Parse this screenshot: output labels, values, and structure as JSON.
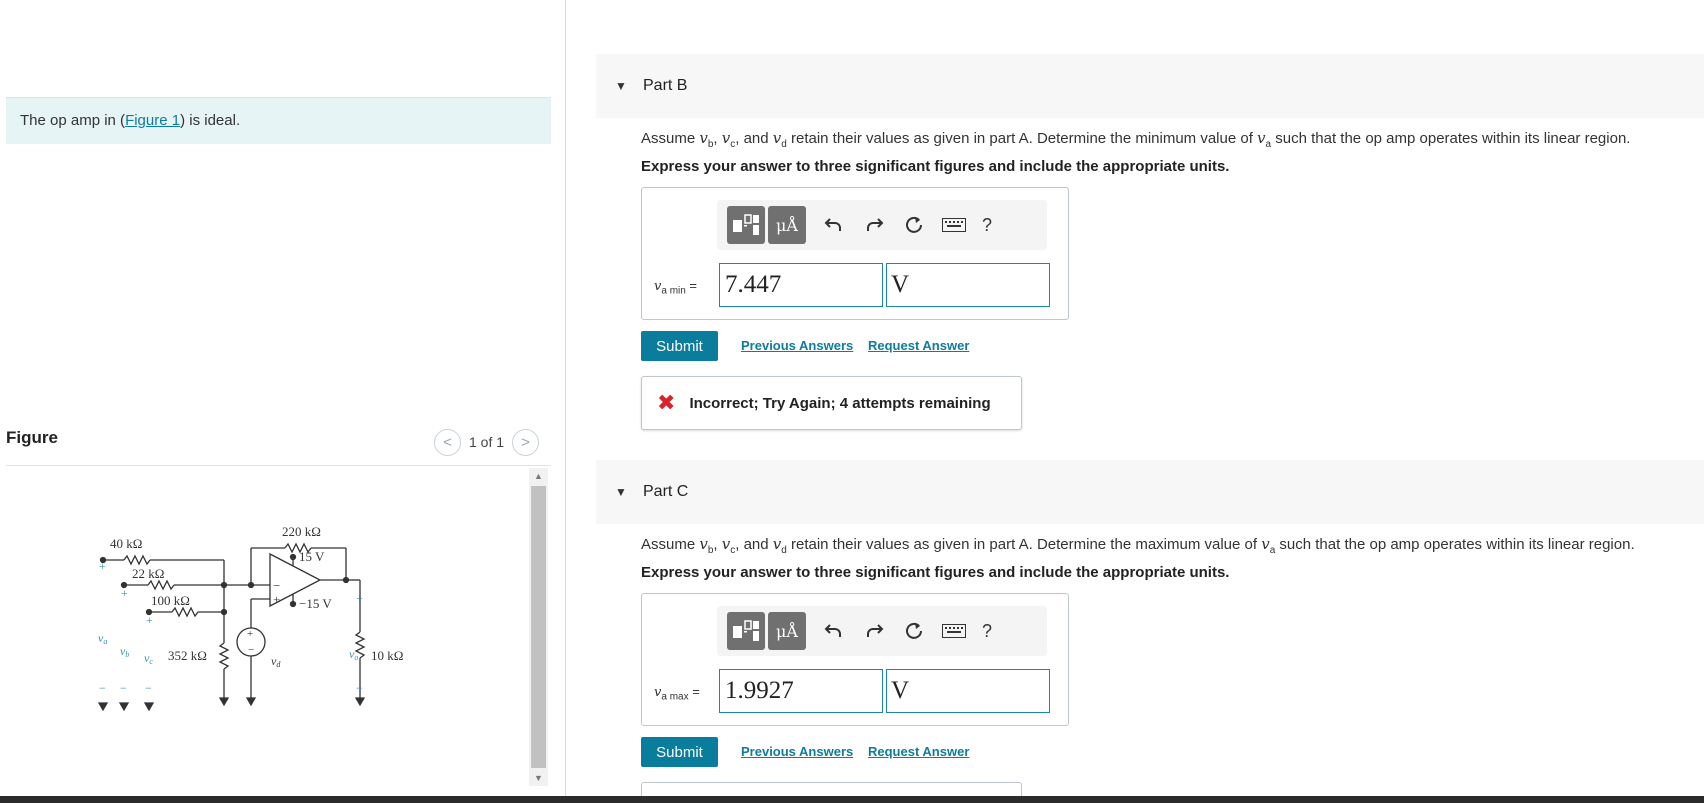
{
  "left": {
    "intro_prefix": "The op amp in (",
    "intro_link": "Figure 1",
    "intro_suffix": ") is ideal.",
    "figure_heading": "Figure",
    "pager_text": "1 of 1",
    "pager_prev": "<",
    "pager_next": ">"
  },
  "circuit": {
    "r1": "40 kΩ",
    "r2": "22 kΩ",
    "r3": "100 kΩ",
    "r4": "352 kΩ",
    "rf": "220 kΩ",
    "rl": "10 kΩ",
    "vpos": "15 V",
    "vneg": "−15 V",
    "plus": "+",
    "minus": "−",
    "va": "v",
    "va_sub": "a",
    "vb": "v",
    "vb_sub": "b",
    "vc": "v",
    "vc_sub": "c",
    "vd": "v",
    "vd_sub": "d",
    "vo": "v",
    "vo_sub": "o"
  },
  "partB": {
    "title": "Part B",
    "q_1": "Assume ",
    "q_vb": "v",
    "q_vb_sub": "b",
    "q_2": ", ",
    "q_vc": "v",
    "q_vc_sub": "c",
    "q_3": ", and ",
    "q_vd": "v",
    "q_vd_sub": "d",
    "q_4": " retain their values as given in part A. Determine the minimum value of ",
    "q_va": "v",
    "q_va_sub": "a",
    "q_5": " such that the op amp operates within its linear region.",
    "instruction": "Express your answer to three significant figures and include the appropriate units.",
    "label_var": "v",
    "label_sub": "a min",
    "label_eq": " =",
    "value": "7.447",
    "unit": "V",
    "submit": "Submit",
    "prev_answers": "Previous Answers",
    "request_answer": "Request Answer",
    "feedback_icon": "✖",
    "feedback": "Incorrect; Try Again; 4 attempts remaining"
  },
  "partC": {
    "title": "Part C",
    "q_1": "Assume ",
    "q_vb": "v",
    "q_vb_sub": "b",
    "q_2": ", ",
    "q_vc": "v",
    "q_vc_sub": "c",
    "q_3": ", and ",
    "q_vd": "v",
    "q_vd_sub": "d",
    "q_4": " retain their values as given in part A. Determine the maximum value of ",
    "q_va": "v",
    "q_va_sub": "a",
    "q_5": " such that the op amp operates within its linear region.",
    "instruction": "Express your answer to three significant figures and include the appropriate units.",
    "label_var": "v",
    "label_sub": "a max",
    "label_eq": " =",
    "value": "1.9927",
    "unit": "V",
    "submit": "Submit",
    "prev_answers": "Previous Answers",
    "request_answer": "Request Answer"
  },
  "toolbar": {
    "units_label": "μÅ",
    "help_label": "?"
  },
  "icons": {
    "caret": "caret-down-icon",
    "template": "templates-icon",
    "undo": "undo-icon",
    "redo": "redo-icon",
    "reset": "reset-icon",
    "keyboard": "keyboard-icon",
    "help": "help-icon",
    "incorrect": "incorrect-x-icon"
  },
  "colors": {
    "accent": "#0a7c9c",
    "link": "#0e7c9d",
    "error": "#d8232a",
    "intro_bg": "#e6f4f5",
    "circuit_label": "#3a8fc0"
  }
}
